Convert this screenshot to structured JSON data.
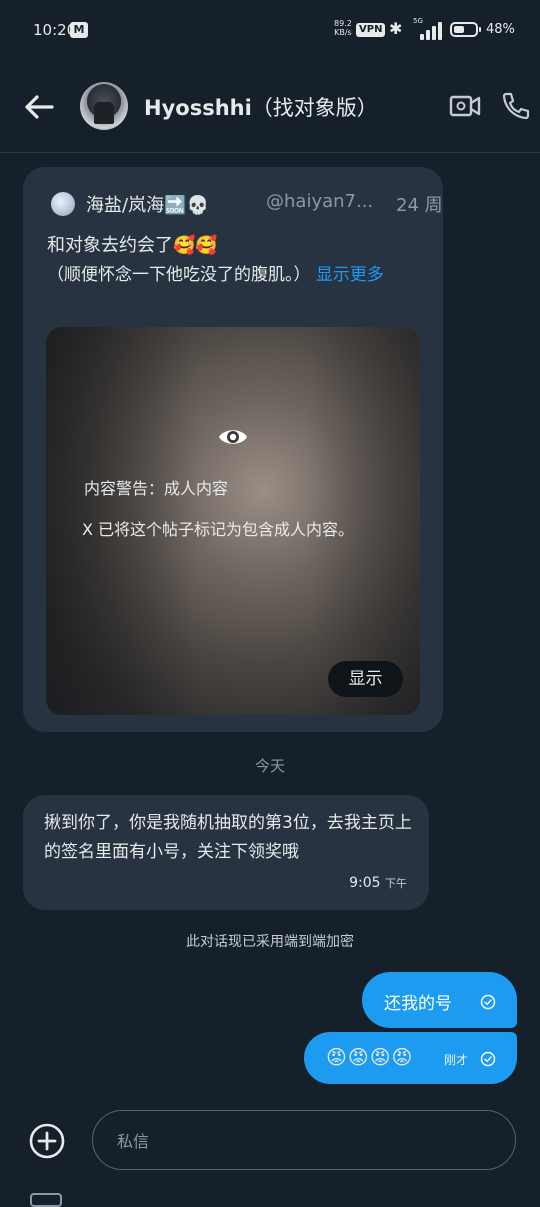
{
  "status_bar": {
    "time": "10:20",
    "mail_icon": "gmail-icon",
    "speed_value": "89.2",
    "speed_unit": "KB/s",
    "vpn": "VPN",
    "bluetooth_icon": "bluetooth-icon",
    "network": "5G",
    "battery_level": 0.48,
    "battery_percent": "48%"
  },
  "header": {
    "back_icon": "arrow-left-icon",
    "name": "Hyosshhi",
    "name_suffix": "（找对象版）",
    "video_icon": "video-camera-icon",
    "phone_icon": "phone-icon"
  },
  "quoted_post": {
    "author": "海盐/岚海🔜💀",
    "handle": "@haiyan7...",
    "time": "24 周",
    "text_line1": "和对象去约会了🥰🥰",
    "text_line2": "（顺便怀念一下他吃没了的腹肌。）",
    "show_more": "显示更多",
    "media": {
      "eye_icon": "eye-icon",
      "warning_title": "内容警告：成人内容",
      "warning_text": "X 已将这个帖子标记为包含成人内容。",
      "show_button": "显示"
    }
  },
  "date_separator": "今天",
  "received_message": {
    "text": "揪到你了，你是我随机抽取的第3位，去我主页上的签名里面有小号，关注下领奖哦",
    "time": "9:05",
    "ampm": "下午"
  },
  "encryption_notice": "此对话现已采用端到端加密",
  "sent_messages": [
    {
      "text": "还我的号",
      "status_icon": "check-circle-icon"
    },
    {
      "text": "😡😡😡😡",
      "meta": "刚才",
      "status_icon": "check-circle-icon"
    }
  ],
  "composer": {
    "add_icon": "plus-circle-icon",
    "placeholder": "私信"
  },
  "colors": {
    "background": "#15202b",
    "bubble_received": "#273340",
    "bubble_sent": "#1d9bf0",
    "link": "#1d9bf0"
  }
}
